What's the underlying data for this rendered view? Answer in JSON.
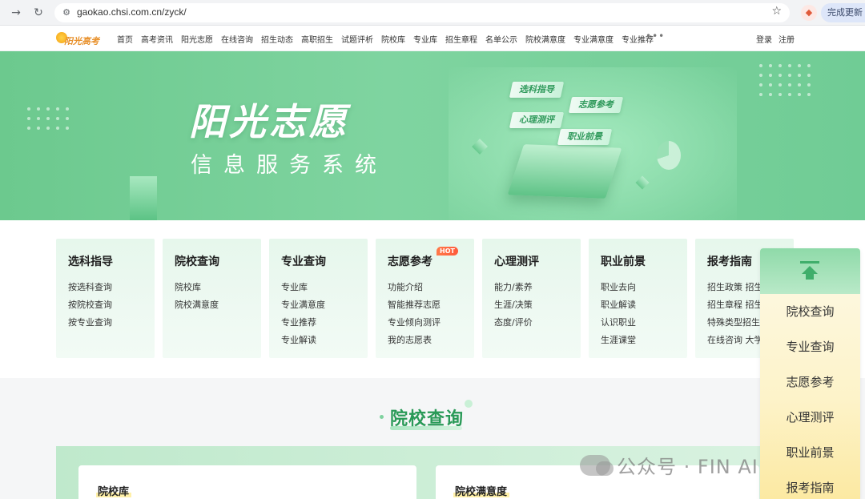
{
  "browser": {
    "url": "gaokao.chsi.com.cn/zyck/",
    "update_label": "完成更新"
  },
  "site": {
    "logo_text": "阳光高考",
    "nav": [
      "首页",
      "高考资讯",
      "阳光志愿",
      "在线咨询",
      "招生动态",
      "高职招生",
      "试题评析",
      "院校库",
      "专业库",
      "招生章程",
      "名单公示",
      "院校满意度",
      "专业满意度",
      "专业推荐"
    ],
    "nav_more": "•••",
    "login": "登录",
    "register": "注册"
  },
  "banner": {
    "title": "阳光志愿",
    "subtitle": "信息服务系统",
    "tags": [
      "选科指导",
      "志愿参考",
      "心理测评",
      "职业前景"
    ]
  },
  "cards": [
    {
      "title": "选科指导",
      "links": [
        "按选科查询",
        "按院校查询",
        "按专业查询"
      ]
    },
    {
      "title": "院校查询",
      "links": [
        "院校库",
        "院校满意度"
      ]
    },
    {
      "title": "专业查询",
      "links": [
        "专业库",
        "专业满意度",
        "专业推荐",
        "专业解读"
      ]
    },
    {
      "title": "志愿参考",
      "badge": "HOT",
      "links": [
        "功能介绍",
        "智能推荐志愿",
        "专业倾向测评",
        "我的志愿表"
      ]
    },
    {
      "title": "心理测评",
      "links": [
        "能力/素养",
        "生涯/决策",
        "态度/评价"
      ]
    },
    {
      "title": "职业前景",
      "links": [
        "职业去向",
        "职业解读",
        "认识职业",
        "生涯课堂"
      ]
    },
    {
      "title": "报考指南",
      "links": [
        "招生政策  招生",
        "招生章程  招生",
        "特殊类型招生",
        "在线咨询  大学"
      ]
    }
  ],
  "section": {
    "title": "院校查询",
    "sub_cards": [
      "院校库",
      "院校满意度"
    ]
  },
  "side_panel": {
    "items": [
      "院校查询",
      "专业查询",
      "志愿参考",
      "心理测评",
      "职业前景",
      "报考指南"
    ]
  },
  "watermark": "公众号 · FIN AI 探索"
}
